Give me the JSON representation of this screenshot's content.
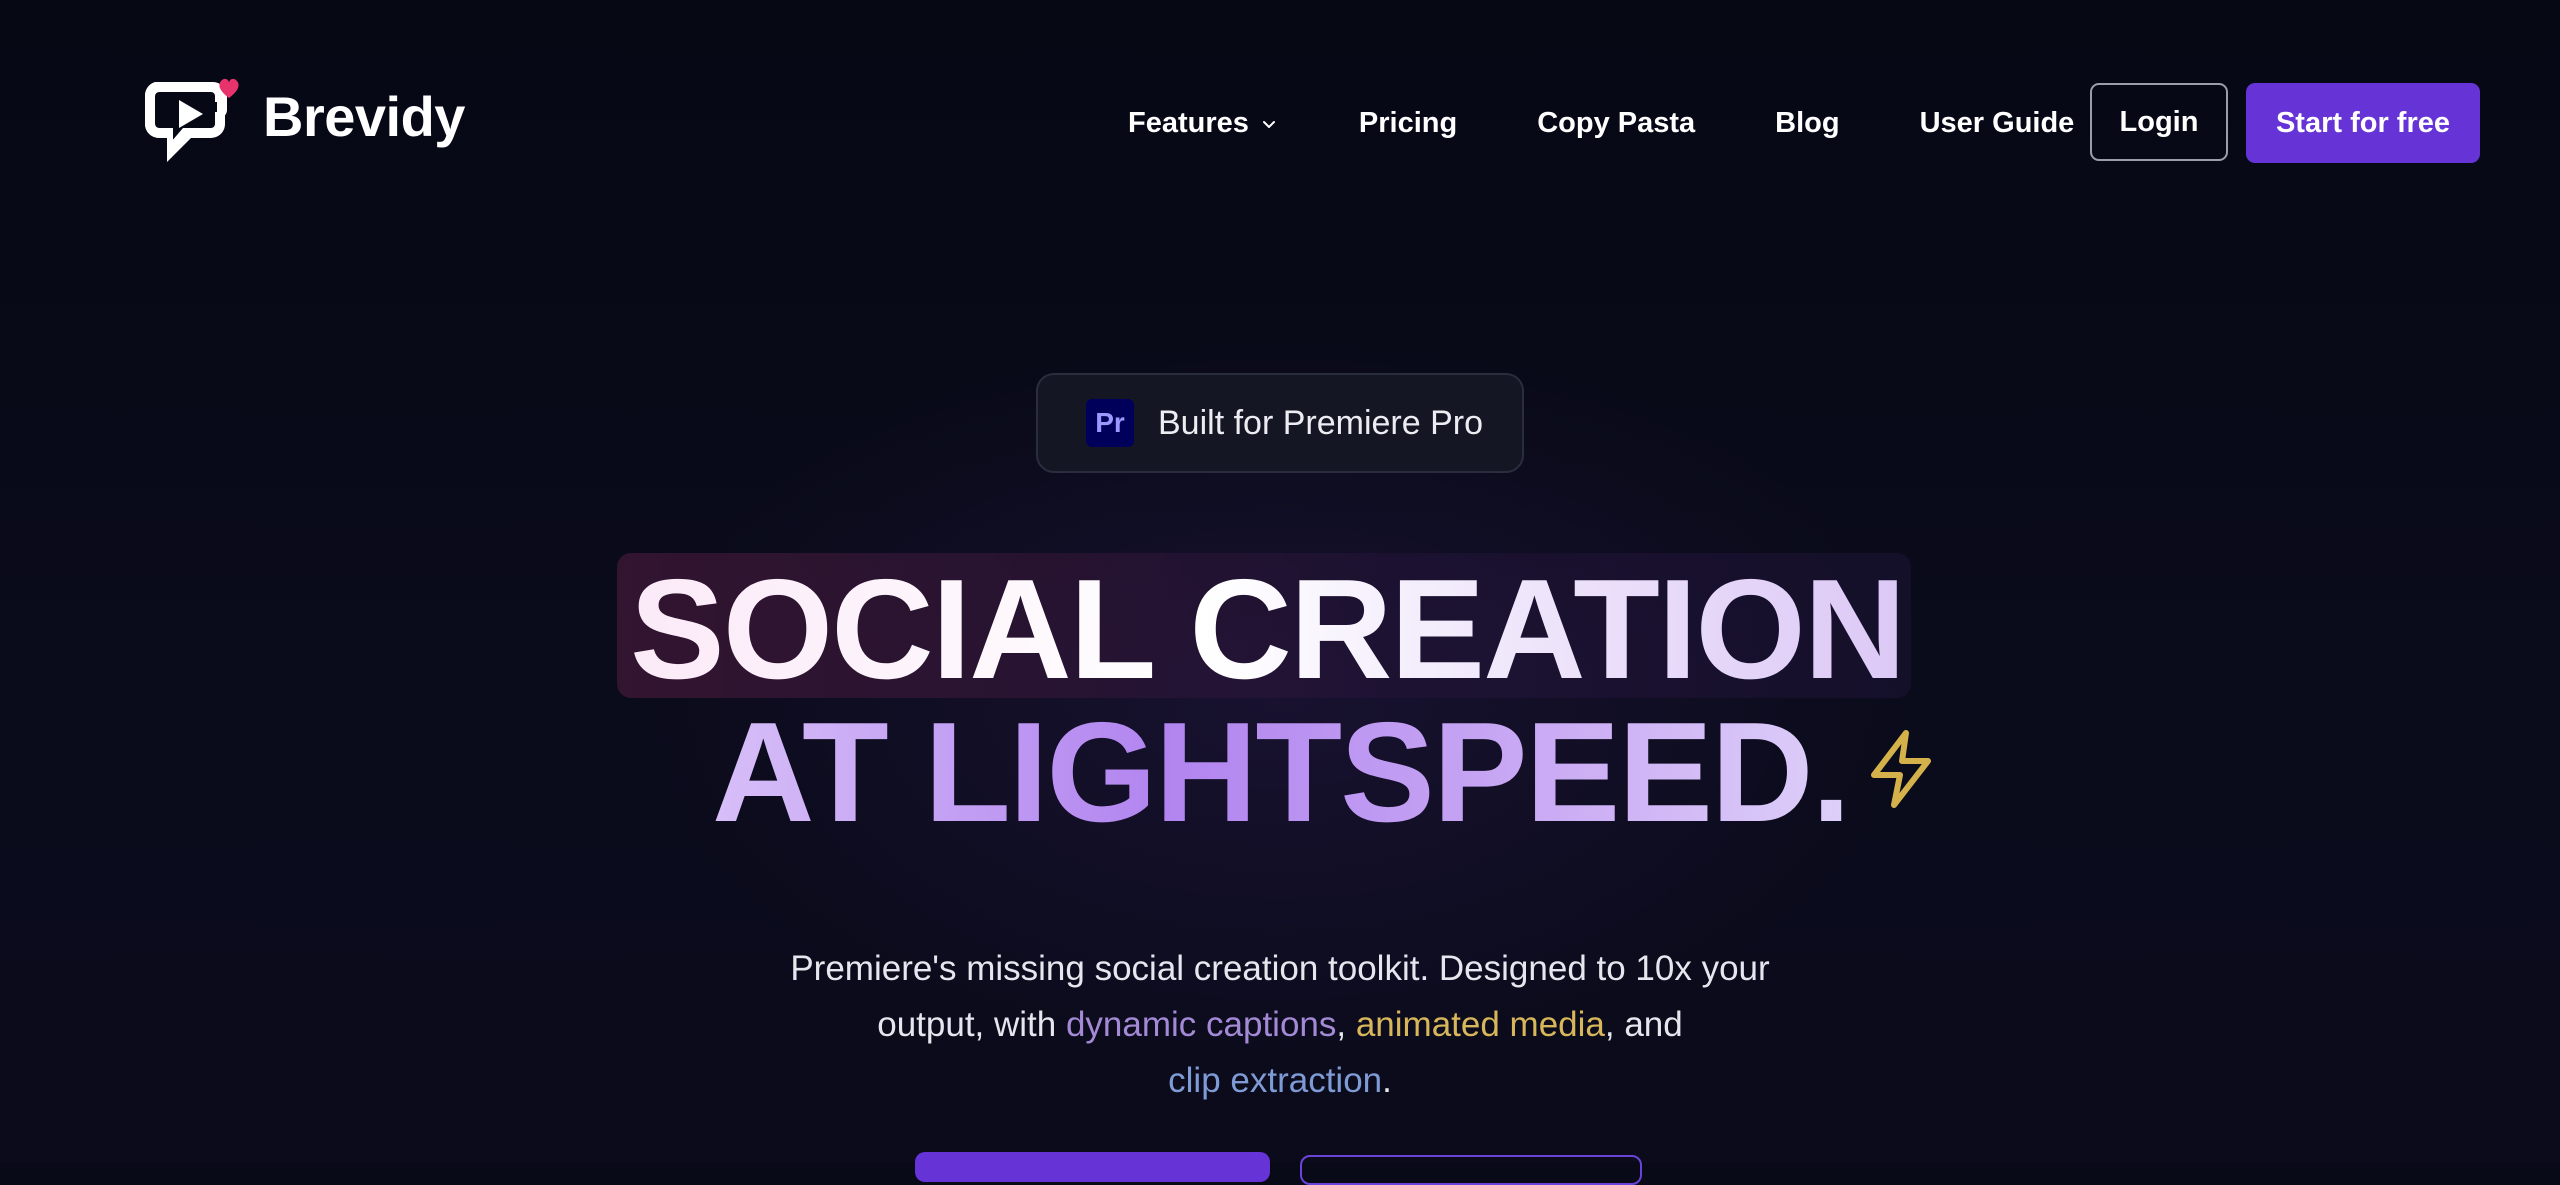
{
  "brand": {
    "name": "Brevidy",
    "logo_icon": "play-chat-heart-icon",
    "accent_heart_color": "#e8336d"
  },
  "nav": {
    "items": [
      {
        "label": "Features",
        "has_dropdown": true
      },
      {
        "label": "Pricing"
      },
      {
        "label": "Copy Pasta"
      },
      {
        "label": "Blog"
      },
      {
        "label": "User Guide"
      }
    ],
    "login_label": "Login",
    "start_label": "Start for free"
  },
  "hero": {
    "badge_icon_text": "Pr",
    "badge_text": "Built for Premiere Pro",
    "headline_line1": "SOCIAL CREATION",
    "headline_line2": "AT LIGHTSPEED.",
    "headline_icon": "lightning-bolt-icon",
    "subtitle_part1": "Premiere's missing social creation toolkit. Designed to 10x your output, with ",
    "subtitle_captions": "dynamic captions",
    "subtitle_sep1": ", ",
    "subtitle_media": "animated media",
    "subtitle_sep2": ", and ",
    "subtitle_clip": "clip extraction",
    "subtitle_end": "."
  },
  "colors": {
    "background": "#080a17",
    "primary_button": "#6533d6",
    "captions_highlight": "#a48ad6",
    "media_highlight": "#d8b75a",
    "clip_highlight": "#7f9bd6",
    "bolt": "#d4b14a"
  }
}
